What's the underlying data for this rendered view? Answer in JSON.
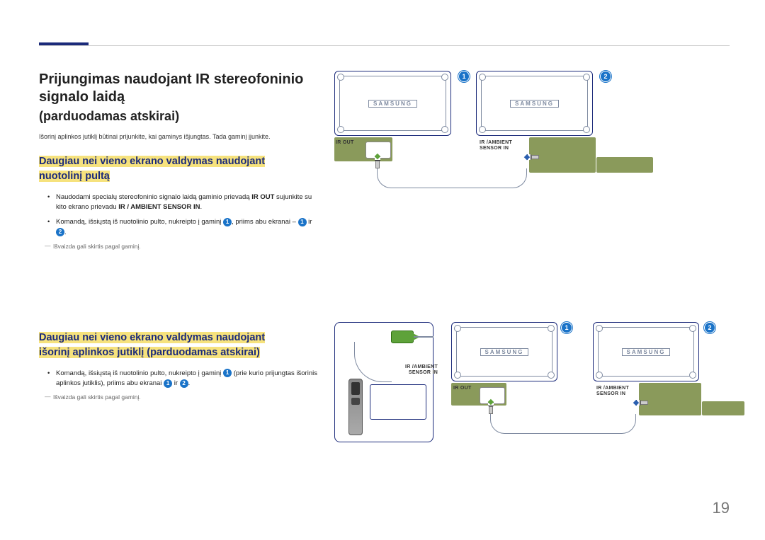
{
  "page_number": "19",
  "heading_line1": "Prijungimas naudojant IR stereofoninio",
  "heading_line2": "signalo laidą",
  "heading_line3": "(parduodamas atskirai)",
  "intro_note": "Išorinį aplinkos jutiklį būtinai prijunkite, kai gaminys išjungtas. Tada gaminį įjunkite.",
  "section1": {
    "title_l1": "Daugiau nei vieno ekrano valdymas naudojant",
    "title_l2": "nuotolinį pultą",
    "bullet1_a": "Naudodami specialų stereofoninio signalo laidą gaminio prievadą ",
    "bullet1_b": "IR OUT",
    "bullet1_c": " sujunkite su kito ekrano prievadu ",
    "bullet1_d": "IR / AMBIENT SENSOR IN",
    "bullet1_e": ".",
    "bullet2_a": "Komandą, išsiųstą iš nuotolinio pulto, nukreipto į gaminį ",
    "bullet2_b": ", priims abu ekranai – ",
    "bullet2_c": " ir ",
    "bullet2_d": "."
  },
  "footnote": "Išvaizda gali skirtis pagal gaminį.",
  "section2": {
    "title_l1": "Daugiau nei vieno ekrano valdymas naudojant",
    "title_l2": "išorinį aplinkos jutiklį (parduodamas atskirai)",
    "bullet1_a": "Komandą, išsiųstą iš nuotolinio pulto, nukreipto į gaminį ",
    "bullet1_b": " (prie kurio prijungtas išorinis aplinkos jutiklis), priims abu ekranai ",
    "bullet1_c": " ir ",
    "bullet1_d": "."
  },
  "labels": {
    "ir_out": "IR OUT",
    "ir_ambient_l1": "IR /AMBIENT",
    "ir_ambient_l2": "SENSOR IN",
    "logo": "SAMSUNG"
  },
  "badges": {
    "one": "1",
    "two": "2"
  }
}
